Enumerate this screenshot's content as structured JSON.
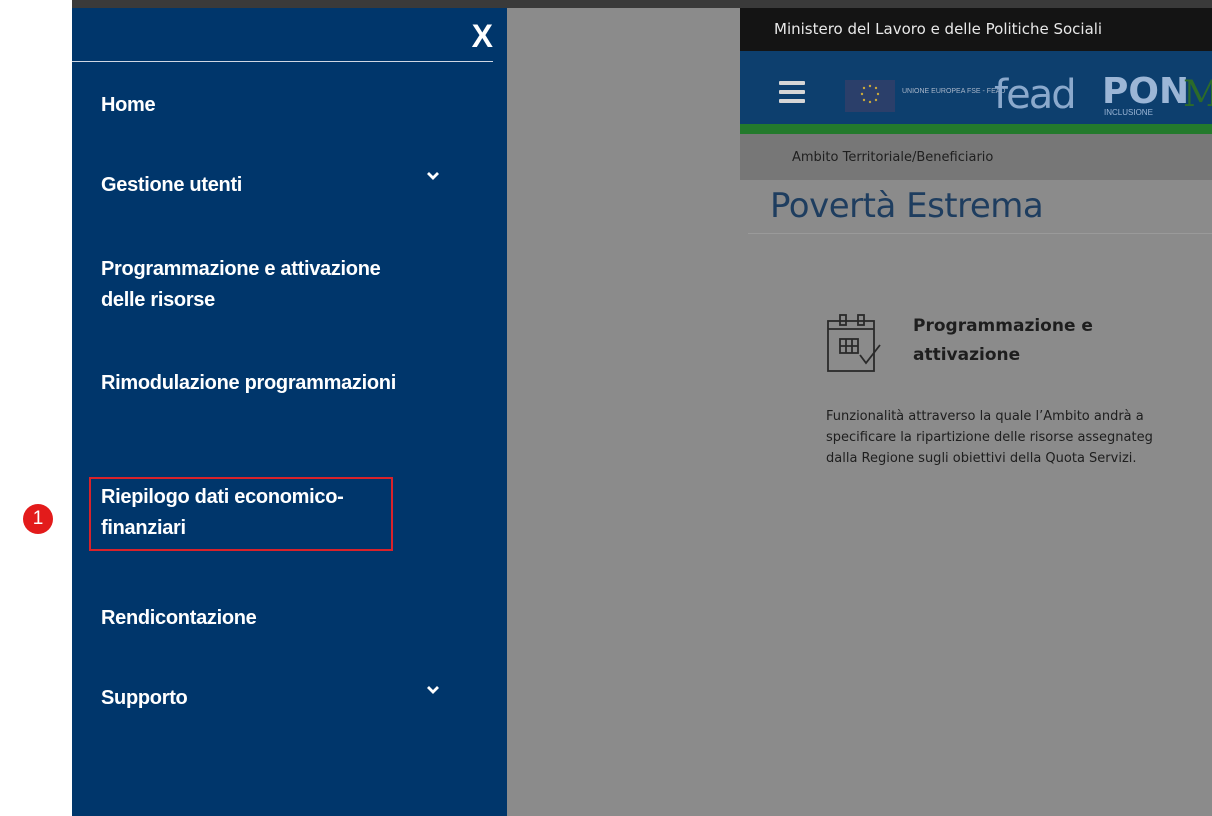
{
  "sidebar": {
    "close_label": "X",
    "items": [
      {
        "label": "Home",
        "has_submenu": false
      },
      {
        "label": "Gestione utenti",
        "has_submenu": true
      },
      {
        "label": "Programmazione e attivazione delle risorse",
        "has_submenu": false
      },
      {
        "label": "Rimodulazione programmazioni",
        "has_submenu": false
      },
      {
        "label": "Riepilogo dati economico-finanziari",
        "has_submenu": false
      },
      {
        "label": "Rendicontazione",
        "has_submenu": false
      },
      {
        "label": "Supporto",
        "has_submenu": true
      }
    ]
  },
  "annotation": {
    "step_number": "1",
    "highlight_color": "#d9222a"
  },
  "header": {
    "ministry": "Ministero del Lavoro e delle Politiche Sociali",
    "eu_logo_text": "UNIONE EUROPEA FSE - FEAD",
    "fead_logo": "fead",
    "pon_logo": "PON",
    "pon_sub": "INCLUSIONE",
    "m_logo": "M"
  },
  "breadcrumb": "Ambito Territoriale/Beneficiario",
  "page_title": "Povertà Estrema",
  "card": {
    "icon": "calendar-icon",
    "title": "Programmazione e attivazione",
    "description_lines": [
      "Funzionalità attraverso la quale l’Ambito andrà a",
      "specificare la ripartizione delle risorse assegnateg",
      "dalla Regione sugli obiettivi della Quota Servizi."
    ]
  },
  "colors": {
    "sidebar_bg": "#00366b",
    "overlay": "#8b8b8b",
    "header_bar": "#0d3f6e",
    "header_green": "#237a2c"
  }
}
